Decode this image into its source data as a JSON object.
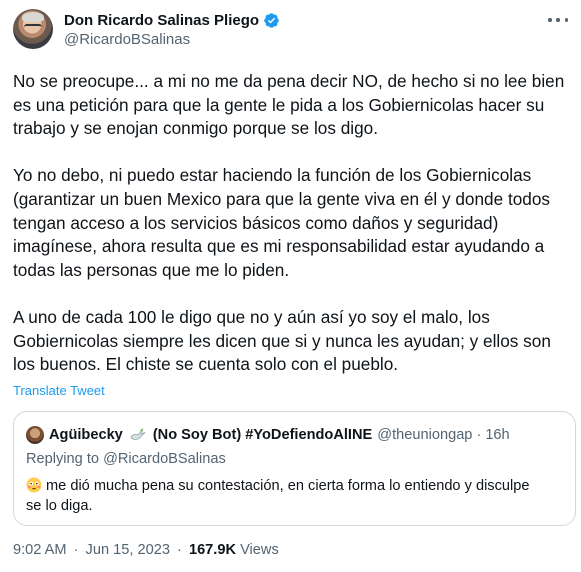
{
  "author": {
    "display_name": "Don Ricardo Salinas Pliego",
    "handle": "@RicardoBSalinas",
    "verified_icon": "verified-badge-icon",
    "avatar_icon": "user-avatar"
  },
  "more_icon": "more-options-icon",
  "tweet": {
    "paragraphs": [
      "No se preocupe... a mi no me da pena decir NO, de hecho si no lee bien\nes una petición para que la gente le pida a los Gobiernicolas hacer su\ntrabajo y se enojan conmigo porque se los digo.",
      "Yo no debo, ni puedo estar haciendo la función de los Gobiernicolas\n(garantizar un buen Mexico para que la gente viva en él y donde todos\ntengan acceso a los servicios básicos como daños y seguridad)\nimagínese, ahora resulta que es mi responsabilidad estar ayudando a\ntodas las personas que me lo piden.",
      "A uno de cada 100 le digo que no y aún así yo soy el malo, los\nGobiernicolas siempre les dicen que si y nunca les ayudan; y ellos son\nlos buenos. El chiste se cuenta solo con el pueblo."
    ],
    "translate_label": "Translate Tweet"
  },
  "quote": {
    "name_part1": "Agüibecky",
    "name_part2": "(No Soy Bot) #YoDefiendoAlINE",
    "handle": "@theuniongap",
    "separator": "·",
    "time": "16h",
    "replying_prefix": "Replying to",
    "replying_mention": "@RicardoBSalinas",
    "text": "me dió mucha pena su contestación, en cierta forma lo entiendo y disculpe\nse lo diga.",
    "emoji_icon": "flushed-face-emoji-icon",
    "dove_icon": "dove-emoji-icon"
  },
  "meta": {
    "time": "9:02 AM",
    "date": "Jun 15, 2023",
    "separator": "·",
    "views_count": "167.9K",
    "views_label": "Views"
  },
  "colors": {
    "text": "#0f1419",
    "secondary": "#536471",
    "link": "#1d9bf0",
    "border": "#cfd9de",
    "verified": "#1d9bf0"
  }
}
